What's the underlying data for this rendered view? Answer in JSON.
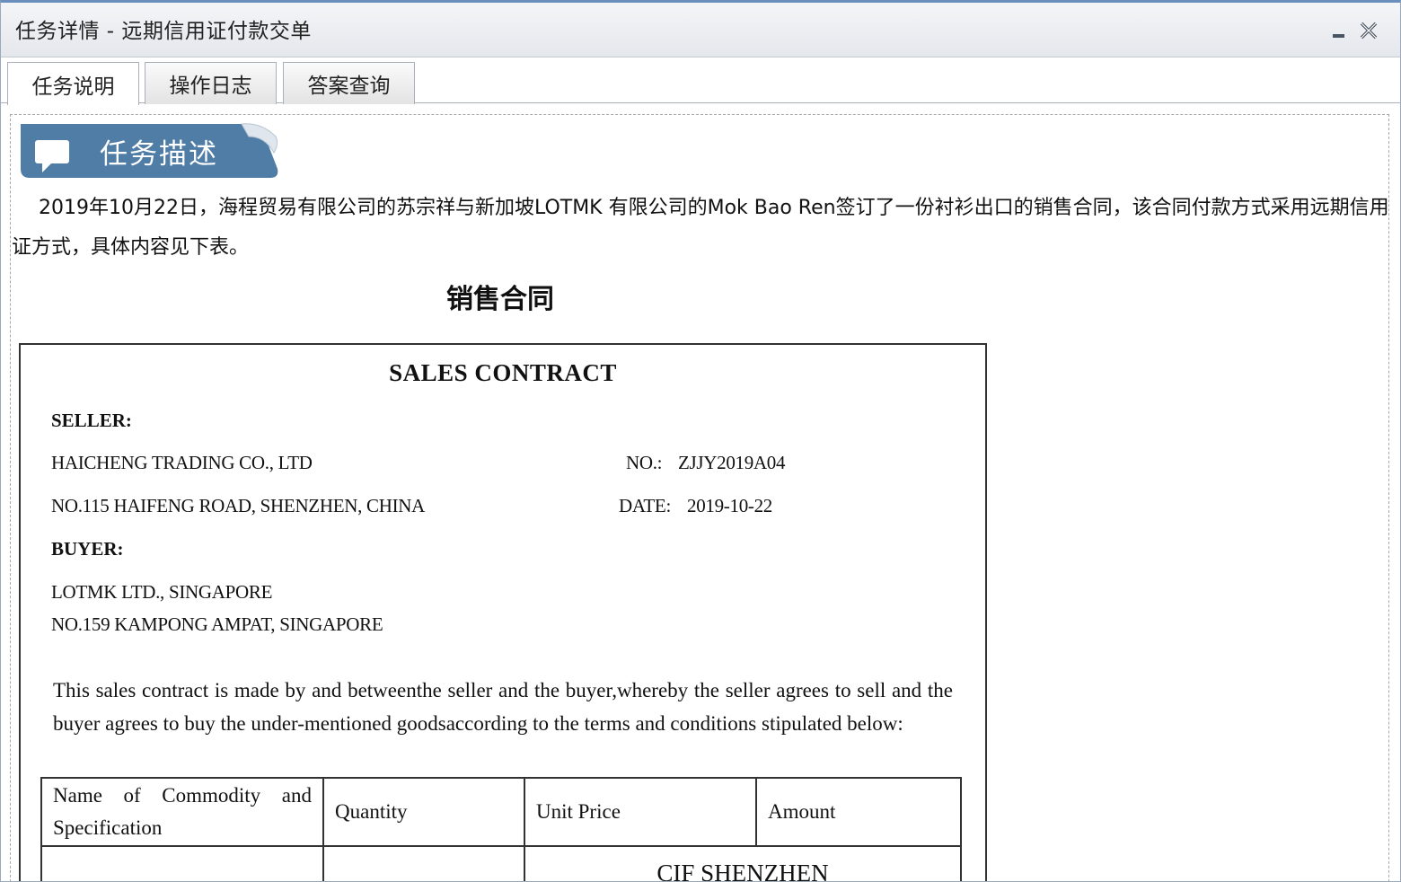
{
  "window": {
    "title": "任务详情 - 远期信用证付款交单",
    "controls": {
      "minimize_icon": "minimize-icon",
      "close_icon": "close-icon"
    }
  },
  "tabs": [
    {
      "label": "任务说明",
      "active": true
    },
    {
      "label": "操作日志",
      "active": false
    },
    {
      "label": "答案查询",
      "active": false
    }
  ],
  "task": {
    "badge_label": "任务描述",
    "badge_icon": "speech-bubble-icon",
    "description": "2019年10月22日，海程贸易有限公司的苏宗祥与新加坡LOTMK 有限公司的Mok Bao Ren签订了一份衬衫出口的销售合同，该合同付款方式采用远期信用证方式，具体内容见下表。"
  },
  "contract": {
    "heading": "销售合同",
    "title": "SALES CONTRACT",
    "seller_label": "SELLER:",
    "seller_name": "HAICHENG TRADING CO., LTD",
    "seller_address": "NO.115 HAIFENG ROAD,  SHENZHEN,  CHINA",
    "no_label": "NO.:",
    "no_value": "ZJJY2019A04",
    "date_label": "DATE:",
    "date_value": "2019-10-22",
    "buyer_label": "BUYER:",
    "buyer_name": "LOTMK LTD., SINGAPORE",
    "buyer_address": "NO.159 KAMPONG AMPAT,  SINGAPORE",
    "clause": "This sales contract is made by and betweenthe seller and the buyer,whereby the seller agrees to sell and the buyer agrees to buy the under-mentioned goodsaccording to the terms and conditions stipulated below:",
    "table": {
      "headers": [
        "Name of Commodity and Specification",
        "Quantity",
        "Unit Price",
        "Amount"
      ],
      "trade_term": "CIF SHENZHEN"
    }
  },
  "colors": {
    "badge": "#4f7da6",
    "title_accent": "#6a8fbd"
  }
}
